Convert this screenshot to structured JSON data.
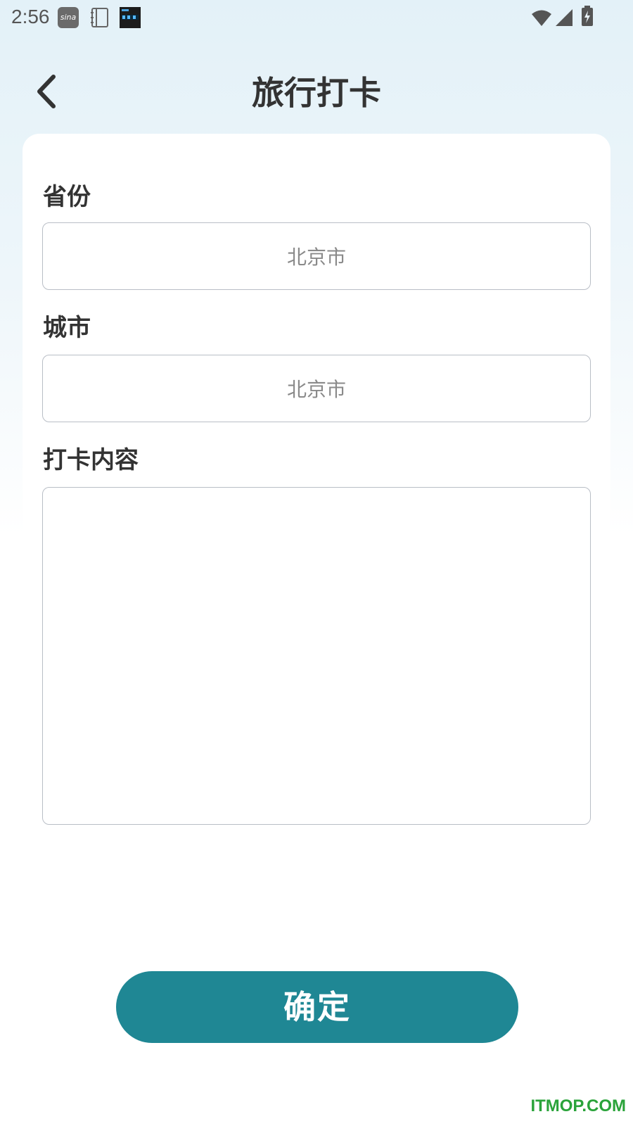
{
  "status_bar": {
    "time": "2:56",
    "icons": [
      "weibo-icon",
      "notebook-icon",
      "clock-app-icon",
      "wifi-icon",
      "signal-icon",
      "battery-charging-icon"
    ],
    "weibo_text": "sina"
  },
  "header": {
    "title": "旅行打卡",
    "back_icon": "chevron-left-icon"
  },
  "form": {
    "province": {
      "label": "省份",
      "value": "北京市"
    },
    "city": {
      "label": "城市",
      "value": "北京市"
    },
    "content": {
      "label": "打卡内容",
      "value": ""
    }
  },
  "confirm_label": "确定",
  "watermark": "ITMOP.COM",
  "colors": {
    "accent": "#1f8794",
    "title_text": "#333333",
    "input_border": "#b9bec6",
    "watermark": "#2aa33a"
  }
}
